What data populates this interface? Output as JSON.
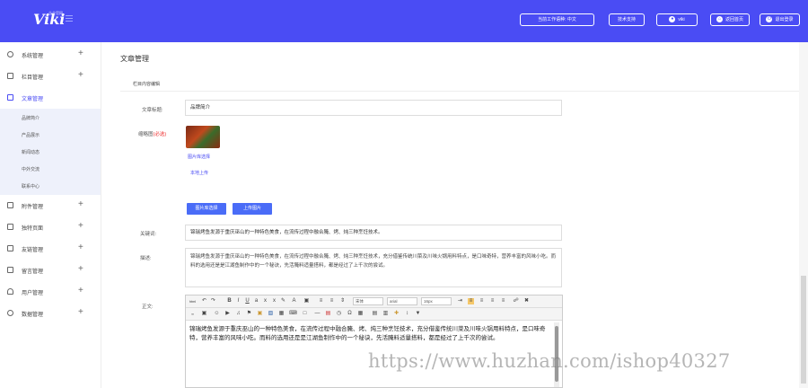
{
  "header": {
    "logo": "Viki",
    "logo_sub": "企业官网",
    "buttons": [
      {
        "label": "当前工作语种: 中文",
        "icon": "none"
      },
      {
        "label": "技术支持",
        "icon": "none"
      },
      {
        "label": "viki",
        "icon": "user-icon"
      },
      {
        "label": "返回首页",
        "icon": "home-icon"
      },
      {
        "label": "退出登录",
        "icon": "power-icon"
      }
    ]
  },
  "sidebar": {
    "items": [
      {
        "label": "系统管理",
        "icon": "gear-icon",
        "active": false
      },
      {
        "label": "栏目管理",
        "icon": "grid-icon",
        "active": false
      },
      {
        "label": "文章管理",
        "icon": "document-icon",
        "active": true
      },
      {
        "label": "附件管理",
        "icon": "folder-icon",
        "active": false
      },
      {
        "label": "独特页面",
        "icon": "page-icon",
        "active": false
      },
      {
        "label": "友链管理",
        "icon": "link-icon",
        "active": false
      },
      {
        "label": "留言管理",
        "icon": "message-icon",
        "active": false
      },
      {
        "label": "用户管理",
        "icon": "user-icon",
        "active": false
      },
      {
        "label": "数据管理",
        "icon": "database-icon",
        "active": false
      }
    ],
    "subitems": [
      "品牌简介",
      "产品展示",
      "新闻动态",
      "中外交流",
      "联系中心"
    ]
  },
  "main": {
    "title": "文章管理",
    "tab": "栏目内容编辑",
    "fields": {
      "title_label": "文章标题:",
      "title_value": "品牌简介",
      "thumb_label": "缩略图",
      "thumb_req": "(必选)",
      "thumb_select": "图片库选择",
      "thumb_upload": "本地上传",
      "btn_gallery": "图片库选择",
      "btn_upload": "上传图片",
      "keywords_label": "关键词:",
      "keywords_value": "锦瑞烤鱼发源于重庆巫山的一种特色美食，在流传过程中融合腌、烤、炖三种烹饪技术。",
      "desc_label": "描述:",
      "desc_value": "锦瑞烤鱼发源于重庆巫山的一种特色美食，在流传过程中融合腌、烤、炖三种烹饪技术，充分借鉴传统川菜及川味火锅用料特点，是口味奇特，营养丰富的风味小吃。而料的选用还是是江湖鱼制作中的一个秘诀，先活腌料适量搭料，都是经过了上千次的尝试。",
      "content_label": "正文:",
      "content_value": "锦瑞烤鱼发源于重庆巫山的一种特色美食，在流传过程中融合腌、烤、炖三种烹饪技术，充分借鉴传统川菜及川味火锅用料特点，是口味奇特，营养丰富的风味小吃。而料的选用还是是江湖鱼制作中的一个秘诀，先活腌料适量搭料，都是经过了上千次的尝试。"
    },
    "editor": {
      "font_family": "宋体",
      "font_name": "arial",
      "font_size": "16px"
    }
  },
  "watermark": "https://www.huzhan.com/ishop40327"
}
